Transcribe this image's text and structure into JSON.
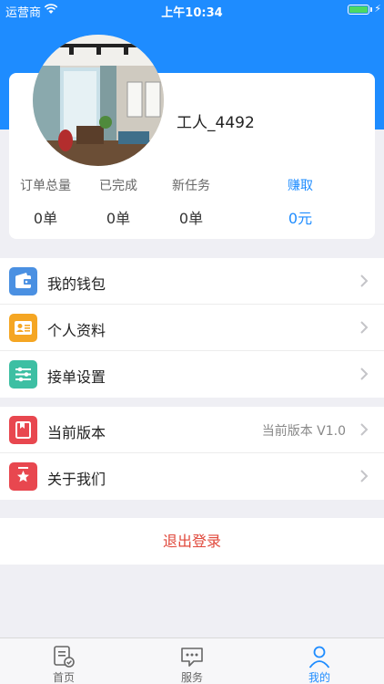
{
  "status_bar": {
    "carrier": "运营商",
    "time": "上午10:34"
  },
  "profile": {
    "username": "工人_4492",
    "stats": [
      {
        "label": "订单总量",
        "value": "0单"
      },
      {
        "label": "已完成",
        "value": "0单"
      },
      {
        "label": "新任务",
        "value": "0单"
      },
      {
        "label": "赚取",
        "value": "0元"
      }
    ]
  },
  "menu_group_1": [
    {
      "label": "我的钱包",
      "icon": "wallet-icon",
      "color": "#4a90e2"
    },
    {
      "label": "个人资料",
      "icon": "profile-card-icon",
      "color": "#f5a623"
    },
    {
      "label": "接单设置",
      "icon": "settings-sliders-icon",
      "color": "#3dbfa3"
    }
  ],
  "menu_group_2": [
    {
      "label": "当前版本",
      "value": "当前版本 V1.0",
      "icon": "version-icon",
      "color": "#e8474f"
    },
    {
      "label": "关于我们",
      "icon": "about-star-icon",
      "color": "#e8474f"
    }
  ],
  "logout_label": "退出登录",
  "tabs": [
    {
      "label": "首页",
      "icon": "home-doc-icon"
    },
    {
      "label": "服务",
      "icon": "chat-icon"
    },
    {
      "label": "我的",
      "icon": "person-icon",
      "active": true
    }
  ],
  "colors": {
    "primary": "#1e8cff",
    "danger": "#e0483b",
    "background": "#efeff4"
  }
}
